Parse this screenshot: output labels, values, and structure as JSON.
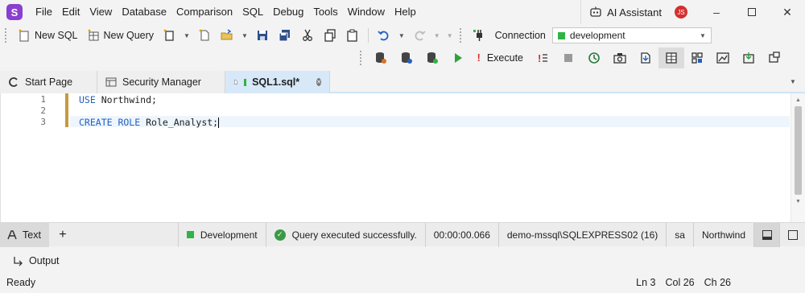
{
  "app": {
    "logo_letter": "S",
    "menu": [
      "File",
      "Edit",
      "View",
      "Database",
      "Comparison",
      "SQL",
      "Debug",
      "Tools",
      "Window",
      "Help"
    ],
    "ai_assistant": "AI Assistant",
    "avatar_initials": "JS"
  },
  "toolbar": {
    "new_sql": "New SQL",
    "new_query": "New Query",
    "connection_label": "Connection",
    "connection_value": "development",
    "execute": "Execute"
  },
  "tabs": [
    {
      "label": "Start Page",
      "icon": "start-page-icon"
    },
    {
      "label": "Security Manager",
      "icon": "security-manager-icon"
    },
    {
      "label": "SQL1.sql*",
      "icon": "sql-document-icon",
      "active": true
    }
  ],
  "editor": {
    "line_numbers": [
      "1",
      "2",
      "3"
    ],
    "lines": [
      {
        "keyword": "USE",
        "rest": " Northwind;"
      },
      {
        "keyword": "",
        "rest": ""
      },
      {
        "keyword": "CREATE ROLE",
        "rest": " Role_Analyst;"
      }
    ]
  },
  "status": {
    "text_tab": "Text",
    "environment": "Development",
    "message": "Query executed successfully.",
    "duration": "00:00:00.066",
    "server": "demo-mssql\\SQLEXPRESS02 (16)",
    "user": "sa",
    "database": "Northwind"
  },
  "output": {
    "label": "Output"
  },
  "footer": {
    "ready": "Ready",
    "ln": "Ln 3",
    "col": "Col 26",
    "ch": "Ch 26"
  },
  "colors": {
    "accent": "#8a3fd1",
    "connection_status": "#2fb344",
    "keyword": "#2360c4",
    "change_marker": "#c79a3c",
    "active_tab": "#d7e8f8"
  }
}
